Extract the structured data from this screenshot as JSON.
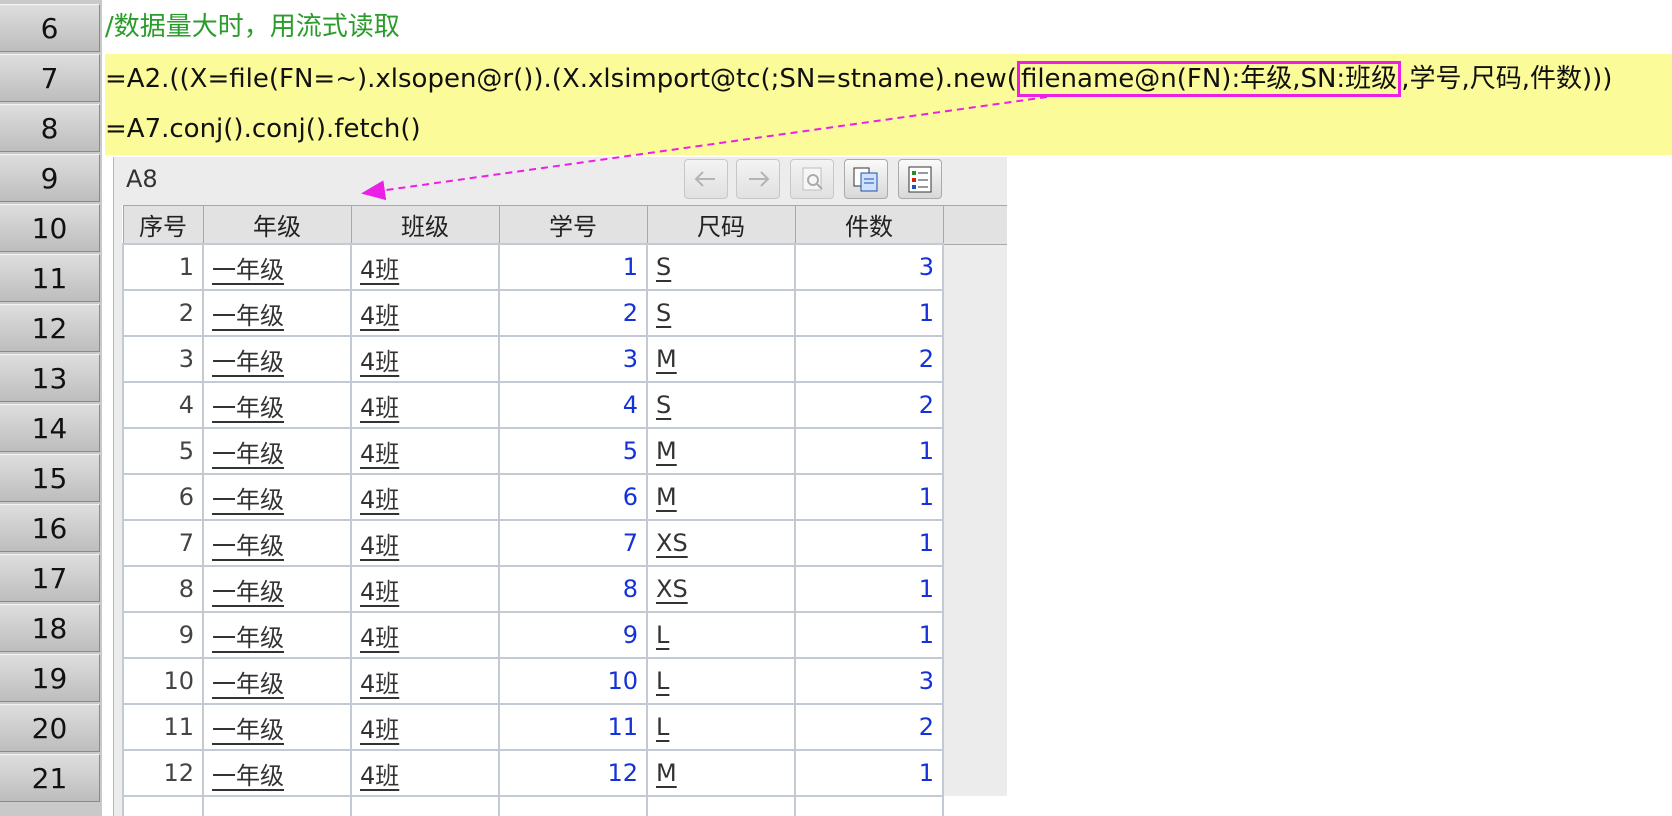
{
  "rows": [
    "6",
    "7",
    "8",
    "9",
    "10",
    "11",
    "12",
    "13",
    "14",
    "15",
    "16",
    "17",
    "18",
    "19",
    "20",
    "21"
  ],
  "code": {
    "comment": "/数据量大时，用流式读取",
    "line7_pre": "=A2.((X=file(FN=~).xlsopen@r()).(X.xlsimport@tc(;SN=stname).new(",
    "line7_hl": "filename@n(FN):年级,SN:班级",
    "line7_post": ",学号,尺码,件数)))",
    "line8": "=A7.conj().conj().fetch()"
  },
  "panel": {
    "cell_name": "A8",
    "columns": [
      "序号",
      "年级",
      "班级",
      "学号",
      "尺码",
      "件数"
    ],
    "records": [
      [
        "1",
        "一年级",
        "4班",
        "1",
        "S",
        "3"
      ],
      [
        "2",
        "一年级",
        "4班",
        "2",
        "S",
        "1"
      ],
      [
        "3",
        "一年级",
        "4班",
        "3",
        "M",
        "2"
      ],
      [
        "4",
        "一年级",
        "4班",
        "4",
        "S",
        "2"
      ],
      [
        "5",
        "一年级",
        "4班",
        "5",
        "M",
        "1"
      ],
      [
        "6",
        "一年级",
        "4班",
        "6",
        "M",
        "1"
      ],
      [
        "7",
        "一年级",
        "4班",
        "7",
        "XS",
        "1"
      ],
      [
        "8",
        "一年级",
        "4班",
        "8",
        "XS",
        "1"
      ],
      [
        "9",
        "一年级",
        "4班",
        "9",
        "L",
        "1"
      ],
      [
        "10",
        "一年级",
        "4班",
        "10",
        "L",
        "3"
      ],
      [
        "11",
        "一年级",
        "4班",
        "11",
        "L",
        "2"
      ],
      [
        "12",
        "一年级",
        "4班",
        "12",
        "M",
        "1"
      ]
    ]
  },
  "colors": {
    "highlight": "#ec1fe6",
    "comment": "#2a9c2a",
    "value_blue": "#1432d8",
    "code_bg": "#fbfb99"
  },
  "icons": [
    "back-arrow-icon",
    "forward-arrow-icon",
    "zoom-icon",
    "copy-icon",
    "settings-icon"
  ]
}
